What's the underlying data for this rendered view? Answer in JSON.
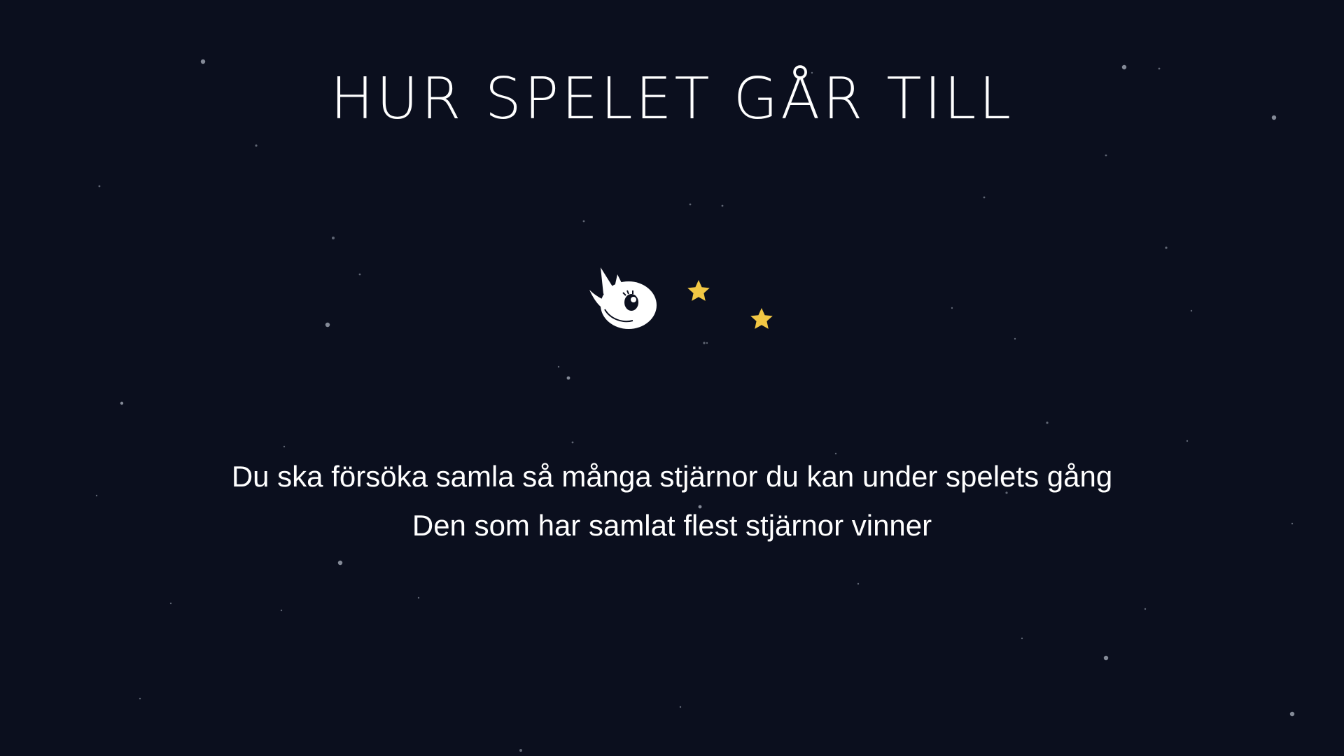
{
  "screen": {
    "title": "HUR SPELET GÅR TILL",
    "instructions": [
      "Du ska försöka samla så många stjärnor du kan under spelets gång",
      "Den som har samlat flest stjärnor vinner"
    ]
  },
  "illustration": {
    "character_icon": "unicorn-creature-icon",
    "collectible_icon": "star-icon",
    "collectible_count": 2
  },
  "colors": {
    "background": "#0b0f1e",
    "text": "#ffffff",
    "star": "#f2c744",
    "background_dot": "#9aa0ad"
  }
}
